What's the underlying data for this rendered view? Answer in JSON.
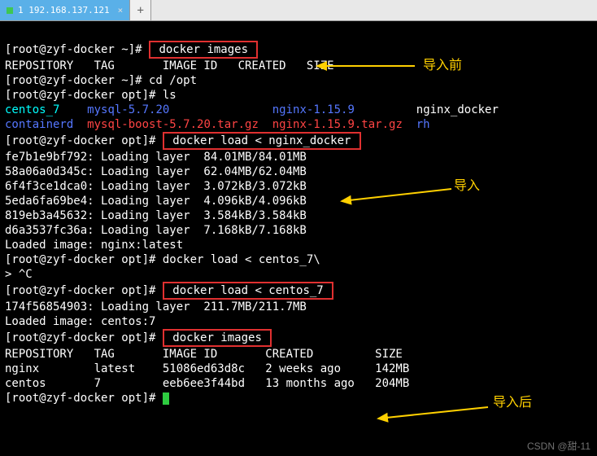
{
  "tab": {
    "label": "1 192.168.137.121",
    "close": "×",
    "new_tab_label": "+"
  },
  "lines": {
    "p1": "[root@zyf-docker ~]# ",
    "cmd1": " docker images ",
    "hdr1": "REPOSITORY   TAG       IMAGE ID   CREATED   SIZE",
    "p2": "[root@zyf-docker ~]# cd /opt",
    "p3": "[root@zyf-docker opt]# ls",
    "f_centos": "centos_7",
    "f_mysql": "mysql-5.7.20",
    "f_nginx": "nginx-1.15.9",
    "f_ngdocker": "nginx_docker",
    "f_containerd": "containerd",
    "f_mysqlboost": "mysql-boost-5.7.20.tar.gz",
    "f_nginxtar": "nginx-1.15.9.tar.gz",
    "f_rh": "rh",
    "p4": "[root@zyf-docker opt]# ",
    "cmd2": " docker load < nginx_docker ",
    "l1": "fe7b1e9bf792: Loading layer  84.01MB/84.01MB",
    "l2": "58a06a0d345c: Loading layer  62.04MB/62.04MB",
    "l3": "6f4f3ce1dca0: Loading layer  3.072kB/3.072kB",
    "l4": "5eda6fa69be4: Loading layer  4.096kB/4.096kB",
    "l5": "819eb3a45632: Loading layer  3.584kB/3.584kB",
    "l6": "d6a3537fc36a: Loading layer  7.168kB/7.168kB",
    "loaded1": "Loaded image: nginx:latest",
    "p5": "[root@zyf-docker opt]# docker load < centos_7\\",
    "p6": "> ^C",
    "p7": "[root@zyf-docker opt]# ",
    "cmd3": " docker load < centos_7 ",
    "l7": "174f56854903: Loading layer  211.7MB/211.7MB",
    "loaded2": "Loaded image: centos:7",
    "p8": "[root@zyf-docker opt]# ",
    "cmd4": " docker images ",
    "hdr2": "REPOSITORY   TAG       IMAGE ID       CREATED         SIZE",
    "row1": "nginx        latest    51086ed63d8c   2 weeks ago     142MB",
    "row2": "centos       7         eeb6ee3f44bd   13 months ago   204MB",
    "p9": "[root@zyf-docker opt]# "
  },
  "annotations": {
    "before": "导入前",
    "import": "导入",
    "after": "导入后"
  },
  "watermark": "CSDN @甜-11"
}
